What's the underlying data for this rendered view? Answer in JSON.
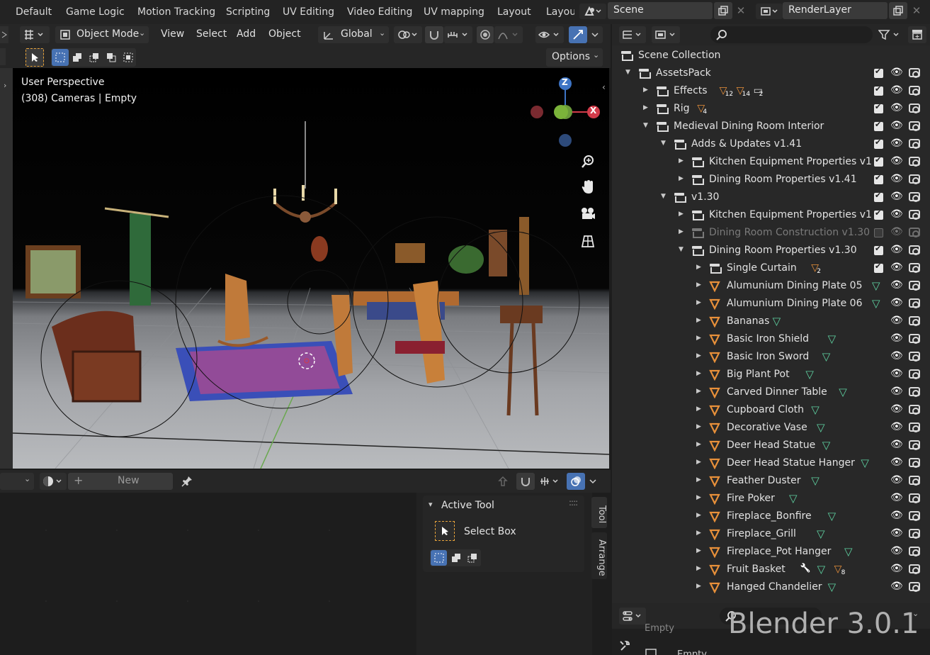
{
  "workspace_tabs": [
    "Default",
    "Game Logic",
    "Motion Tracking",
    "Scripting",
    "UV Editing",
    "Video Editing",
    "UV mapping",
    "Layout",
    "Layou"
  ],
  "scene": {
    "name": "Scene",
    "render_layer": "RenderLayer"
  },
  "viewport_header": {
    "mode": "Object Mode",
    "menus": [
      "View",
      "Select",
      "Add",
      "Object"
    ],
    "transform_orientation": "Global",
    "options_label": "Options"
  },
  "viewport": {
    "perspective_label": "User Perspective",
    "context_label": "(308) Cameras | Empty",
    "gizmo": {
      "z": "Z",
      "x": "X"
    }
  },
  "bottom_header": {
    "new_label": "New"
  },
  "active_tool": {
    "title": "Active Tool",
    "tool_name": "Select Box"
  },
  "side_tabs": [
    "Tool",
    "Arrange"
  ],
  "outliner": {
    "rows": [
      {
        "label": "Scene Collection",
        "type": "scene",
        "indent": 0,
        "expanded": true
      },
      {
        "label": "AssetsPack",
        "type": "collection",
        "indent": 1,
        "expanded": true,
        "checked": true
      },
      {
        "label": "Effects",
        "type": "collection",
        "indent": 2,
        "expanded": false,
        "checked": true,
        "badges": [
          "12",
          "14",
          "2"
        ]
      },
      {
        "label": "Rig",
        "type": "collection",
        "indent": 2,
        "expanded": false,
        "checked": true,
        "badges": [
          "4"
        ]
      },
      {
        "label": "Medieval Dining Room Interior",
        "type": "collection",
        "indent": 2,
        "expanded": true,
        "checked": true
      },
      {
        "label": "Adds & Updates v1.41",
        "type": "collection",
        "indent": 3,
        "expanded": true,
        "checked": true
      },
      {
        "label": "Kitchen Equipment Properties v1",
        "type": "collection",
        "indent": 4,
        "expanded": false,
        "checked": true
      },
      {
        "label": "Dining Room Properties v1.41",
        "type": "collection",
        "indent": 4,
        "expanded": false,
        "checked": true
      },
      {
        "label": "v1.30",
        "type": "collection",
        "indent": 3,
        "expanded": true,
        "checked": true
      },
      {
        "label": "Kitchen Equipment Properties v1",
        "type": "collection",
        "indent": 4,
        "expanded": false,
        "checked": true
      },
      {
        "label": "Dining Room Construction v1.30",
        "type": "collection",
        "indent": 4,
        "expanded": false,
        "checked": false,
        "dim": true
      },
      {
        "label": "Dining Room Properties v1.30",
        "type": "collection",
        "indent": 4,
        "expanded": true,
        "checked": true
      },
      {
        "label": "Single Curtain",
        "type": "collection",
        "indent": 5,
        "expanded": false,
        "checked": true,
        "badges": [
          "2"
        ]
      },
      {
        "label": "Alumunium Dining Plate 05",
        "type": "mesh",
        "indent": 5,
        "expanded": false
      },
      {
        "label": "Alumunium Dining Plate 06",
        "type": "mesh",
        "indent": 5,
        "expanded": false
      },
      {
        "label": "Bananas",
        "type": "mesh",
        "indent": 5,
        "expanded": false
      },
      {
        "label": "Basic Iron Shield",
        "type": "mesh",
        "indent": 5,
        "expanded": false
      },
      {
        "label": "Basic Iron Sword",
        "type": "mesh",
        "indent": 5,
        "expanded": false
      },
      {
        "label": "Big Plant Pot",
        "type": "mesh",
        "indent": 5,
        "expanded": false
      },
      {
        "label": "Carved Dinner Table",
        "type": "mesh",
        "indent": 5,
        "expanded": false
      },
      {
        "label": "Cupboard Cloth",
        "type": "mesh",
        "indent": 5,
        "expanded": false
      },
      {
        "label": "Decorative Vase",
        "type": "mesh",
        "indent": 5,
        "expanded": false
      },
      {
        "label": "Deer Head Statue",
        "type": "mesh",
        "indent": 5,
        "expanded": false
      },
      {
        "label": "Deer Head Statue Hanger",
        "type": "mesh",
        "indent": 5,
        "expanded": false
      },
      {
        "label": "Feather Duster",
        "type": "mesh",
        "indent": 5,
        "expanded": false
      },
      {
        "label": "Fire Poker",
        "type": "mesh",
        "indent": 5,
        "expanded": false
      },
      {
        "label": "Fireplace_Bonfire",
        "type": "mesh",
        "indent": 5,
        "expanded": false
      },
      {
        "label": "Fireplace_Grill",
        "type": "mesh",
        "indent": 5,
        "expanded": false
      },
      {
        "label": "Fireplace_Pot Hanger",
        "type": "mesh",
        "indent": 5,
        "expanded": false
      },
      {
        "label": "Fruit Basket",
        "type": "mesh",
        "indent": 5,
        "expanded": false,
        "badges": [
          "8"
        ]
      },
      {
        "label": "Hanged Chandelier",
        "type": "mesh",
        "indent": 5,
        "expanded": false
      }
    ]
  },
  "properties": {
    "object_name": "Empty",
    "object_name_2": "Empty"
  },
  "watermark": "Blender 3.0.1",
  "colors": {
    "accent_blue": "#4772b3",
    "mesh_orange": "#e8903a",
    "vgroup_green": "#5ed0a0",
    "axis_x": "#d23b4a",
    "axis_y": "#7bb33a",
    "axis_z": "#3d74c5"
  }
}
